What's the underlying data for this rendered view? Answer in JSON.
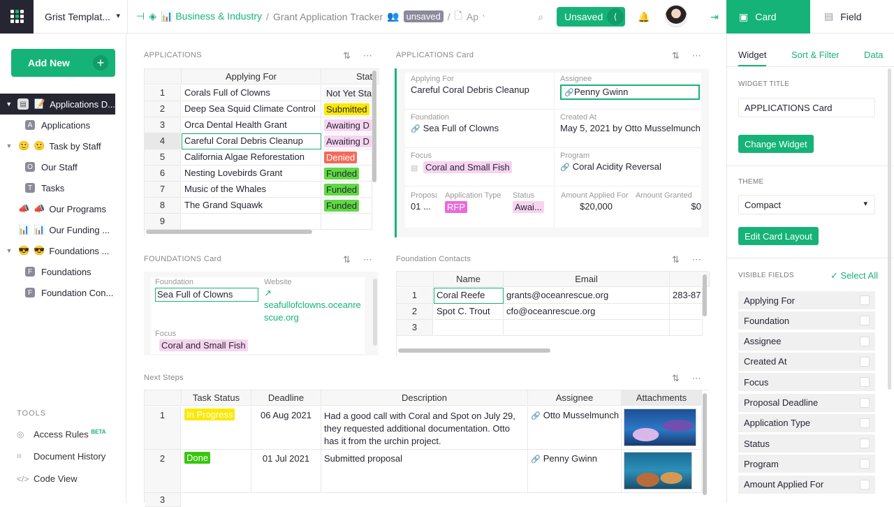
{
  "topbar": {
    "org_name": "Grist Templat...",
    "crumb_workspace": "Business & Industry",
    "crumb_sep": "/",
    "crumb_doc": "Grant Application Tracker",
    "unsaved_pill": "unsaved",
    "crumb_page": "Ap",
    "unsaved_button": "Unsaved"
  },
  "right_tabs": {
    "card": "Card",
    "field": "Field"
  },
  "sidebar": {
    "add_new": "Add New",
    "pages": [
      {
        "label": "Applications D...",
        "emoji": "📝"
      },
      {
        "label": "Applications",
        "badge": "A"
      },
      {
        "label": "Task by Staff",
        "emoji": "🙂"
      },
      {
        "label": "Our Staff",
        "badge": "O"
      },
      {
        "label": "Tasks",
        "badge": "T"
      },
      {
        "label": "Our Programs",
        "emoji": "📣"
      },
      {
        "label": "Our Funding ...",
        "emoji": "📊"
      },
      {
        "label": "Foundations ...",
        "emoji": "😎"
      },
      {
        "label": "Foundations",
        "badge": "F"
      },
      {
        "label": "Foundation Con...",
        "badge": "F"
      }
    ],
    "tools_header": "TOOLS",
    "tools": [
      {
        "label": "Access Rules",
        "sup": "BETA"
      },
      {
        "label": "Document History"
      },
      {
        "label": "Code View"
      }
    ]
  },
  "applications": {
    "title": "APPLICATIONS",
    "columns": [
      "Applying For",
      "Stat"
    ],
    "rows": [
      {
        "n": "1",
        "name": "Corals Full of Clowns",
        "status": "Not Yet Sta",
        "color": "nys"
      },
      {
        "n": "2",
        "name": "Deep Sea Squid Climate Control",
        "status": "Submitted",
        "color": "y"
      },
      {
        "n": "3",
        "name": "Orca Dental Health Grant",
        "status": "Awaiting D",
        "color": "p"
      },
      {
        "n": "4",
        "name": "Careful Coral Debris Cleanup",
        "status": "Awaiting D",
        "color": "p"
      },
      {
        "n": "5",
        "name": "California Algae Reforestation",
        "status": "Denied",
        "color": "r"
      },
      {
        "n": "6",
        "name": "Nesting Lovebirds Grant",
        "status": "Funded",
        "color": "g"
      },
      {
        "n": "7",
        "name": "Music of the Whales",
        "status": "Funded",
        "color": "g"
      },
      {
        "n": "8",
        "name": "The Grand Squawk",
        "status": "Funded",
        "color": "g"
      },
      {
        "n": "9",
        "name": "",
        "status": "",
        "color": ""
      }
    ]
  },
  "app_card": {
    "title": "APPLICATIONS Card",
    "applying_for_label": "Applying For",
    "applying_for": "Careful Coral Debris Cleanup",
    "assignee_label": "Assignee",
    "assignee": "Penny Gwinn",
    "foundation_label": "Foundation",
    "foundation": "Sea Full of Clowns",
    "created_label": "Created At",
    "created": "May 5, 2021 by Otto Musselmunch",
    "focus_label": "Focus",
    "focus": "Coral and Small Fish",
    "program_label": "Program",
    "program": "Coral Acidity Reversal",
    "proposal_label": "Proposa",
    "proposal": "01 ...",
    "apptype_label": "Application Type",
    "apptype": "RFP",
    "status_label": "Status",
    "status": "Awai...",
    "applied_label": "Amount Applied For",
    "applied": "$20,000",
    "granted_label": "Amount Granted",
    "granted": "$0"
  },
  "found_card": {
    "title": "FOUNDATIONS Card",
    "foundation_label": "Foundation",
    "foundation": "Sea Full of Clowns",
    "website_label": "Website",
    "website_line1": "seafullofclowns.oceanre",
    "website_line2": "scue.org",
    "focus_label": "Focus",
    "focus": "Coral and Small Fish"
  },
  "contacts": {
    "title": "Foundation Contacts",
    "columns": [
      "Name",
      "Email"
    ],
    "rows": [
      {
        "n": "1",
        "name": "Coral Reefe",
        "email": "grants@oceanrescue.org",
        "phone": "283-87"
      },
      {
        "n": "2",
        "name": "Spot C. Trout",
        "email": "cfo@oceanrescue.org",
        "phone": ""
      },
      {
        "n": "3",
        "name": "",
        "email": "",
        "phone": ""
      }
    ]
  },
  "next_steps": {
    "title": "Next Steps",
    "columns": [
      "Task Status",
      "Deadline",
      "Description",
      "Assignee",
      "Attachments"
    ],
    "rows": [
      {
        "n": "1",
        "status": "In Progress",
        "deadline": "06 Aug 2021",
        "desc1": "Had a good call with Coral and Spot on July 29,",
        "desc2": "they requested additional documentation. Otto",
        "desc3": "has it from the urchin project.",
        "assignee": "Otto Musselmunch"
      },
      {
        "n": "2",
        "status": "Done",
        "deadline": "01 Jul 2021",
        "desc1": "Submitted proposal",
        "desc2": "",
        "desc3": "",
        "assignee": "Penny Gwinn"
      },
      {
        "n": "3"
      }
    ]
  },
  "right_panel": {
    "subtabs": [
      "Widget",
      "Sort & Filter",
      "Data"
    ],
    "widget_title_label": "WIDGET TITLE",
    "widget_title_value": "APPLICATIONS Card",
    "change_widget": "Change Widget",
    "theme_label": "THEME",
    "theme_value": "Compact",
    "edit_card_layout": "Edit Card Layout",
    "visible_fields_label": "VISIBLE FIELDS",
    "select_all": "Select All",
    "fields": [
      "Applying For",
      "Foundation",
      "Assignee",
      "Created At",
      "Focus",
      "Proposal Deadline",
      "Application Type",
      "Status",
      "Program",
      "Amount Applied For"
    ]
  },
  "colors": {
    "accent": "#16b378",
    "dark": "#262633"
  }
}
